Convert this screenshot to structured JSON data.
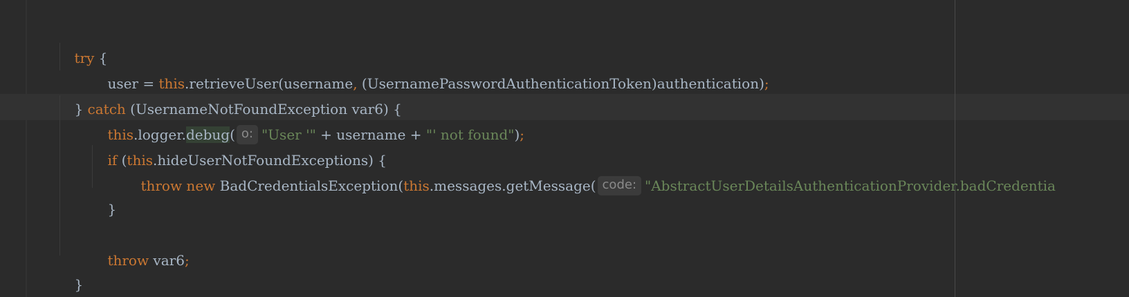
{
  "editor": {
    "lines": [
      {
        "try_kw": "try",
        "open_brace": " {"
      },
      {
        "user_var": "user = ",
        "this_kw": "this",
        "call": ".retrieveUser(username",
        "comma": ",",
        "cast": " (UsernamePasswordAuthenticationToken)authentication)",
        "semi": ";"
      },
      {
        "close_brace": "} ",
        "catch_kw": "catch",
        "rest": " (UsernameNotFoundException var6) {"
      },
      {
        "this_kw": "this",
        "logger": ".logger.",
        "debug": "debug",
        "paren": "(",
        "hint": "o:",
        "str_open": "\"User '\"",
        "concat": " + username + ",
        "str_close": "\"' not found\"",
        "close": ")",
        "semi": ";"
      },
      {
        "if_kw": "if",
        "paren_open": " (",
        "this_kw": "this",
        "field": ".hideUserNotFoundExceptions) {"
      },
      {
        "throw_kw": "throw",
        "new_kw": " new",
        "cls": " BadCredentialsException(",
        "this_kw": "this",
        "msg": ".messages.getMessage(",
        "hint": "code:",
        "str": "\"AbstractUserDetailsAuthenticationProvider.badCredentia"
      },
      {
        "close_brace": "}"
      },
      {
        "throw_kw": "throw",
        "var": " var6",
        "semi": ";"
      },
      {
        "close_brace": "}"
      }
    ]
  }
}
